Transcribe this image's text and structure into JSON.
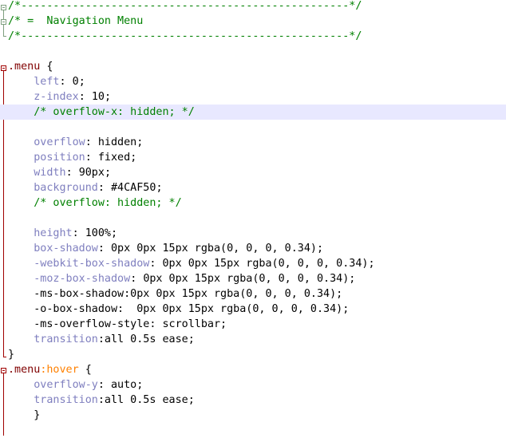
{
  "editor": {
    "lines": [
      [
        [
          "/*---------------------------------------------------*/",
          "t-comment"
        ]
      ],
      [
        [
          "/* =  Navigation Menu",
          "t-comment"
        ]
      ],
      [
        [
          "/*---------------------------------------------------*/",
          "t-comment"
        ]
      ],
      [],
      [
        [
          ".menu",
          "t-selector"
        ],
        [
          " {",
          "t-black"
        ]
      ],
      [
        [
          "    left",
          "t-prop"
        ],
        [
          ": ",
          "t-black"
        ],
        [
          "0",
          "t-black"
        ],
        [
          ";",
          "t-black"
        ]
      ],
      [
        [
          "    z-index",
          "t-prop"
        ],
        [
          ": ",
          "t-black"
        ],
        [
          "10",
          "t-black"
        ],
        [
          ";",
          "t-black"
        ]
      ],
      [
        [
          "    /* overflow-x: hidden; */",
          "t-comment"
        ]
      ],
      [],
      [
        [
          "    overflow",
          "t-prop"
        ],
        [
          ": ",
          "t-black"
        ],
        [
          "hidden",
          "t-black"
        ],
        [
          ";",
          "t-black"
        ]
      ],
      [
        [
          "    position",
          "t-prop"
        ],
        [
          ": ",
          "t-black"
        ],
        [
          "fixed",
          "t-black"
        ],
        [
          ";",
          "t-black"
        ]
      ],
      [
        [
          "    width",
          "t-prop"
        ],
        [
          ": ",
          "t-black"
        ],
        [
          "90px",
          "t-black"
        ],
        [
          ";",
          "t-black"
        ]
      ],
      [
        [
          "    background",
          "t-prop"
        ],
        [
          ": ",
          "t-black"
        ],
        [
          "#4CAF50",
          "t-black"
        ],
        [
          ";",
          "t-black"
        ]
      ],
      [
        [
          "    /* overflow: hidden; */",
          "t-comment"
        ]
      ],
      [],
      [
        [
          "    height",
          "t-prop"
        ],
        [
          ": ",
          "t-black"
        ],
        [
          "100%",
          "t-black"
        ],
        [
          ";",
          "t-black"
        ]
      ],
      [
        [
          "    box-shadow",
          "t-prop"
        ],
        [
          ": ",
          "t-black"
        ],
        [
          "0px 0px 15px rgba(0, 0, 0, 0.34)",
          "t-black"
        ],
        [
          ";",
          "t-black"
        ]
      ],
      [
        [
          "    -webkit-box-shadow",
          "t-prop"
        ],
        [
          ": ",
          "t-black"
        ],
        [
          "0px 0px 15px rgba(0, 0, 0, 0.34)",
          "t-black"
        ],
        [
          ";",
          "t-black"
        ]
      ],
      [
        [
          "    -moz-box-shadow",
          "t-prop"
        ],
        [
          ": ",
          "t-black"
        ],
        [
          "0px 0px 15px rgba(0, 0, 0, 0.34)",
          "t-black"
        ],
        [
          ";",
          "t-black"
        ]
      ],
      [
        [
          "    -ms-box-shadow:0px 0px 15px rgba(0, 0, 0, 0.34);",
          "t-black"
        ]
      ],
      [
        [
          "    -o-box-shadow:  0px 0px 15px rgba(0, 0, 0, 0.34);",
          "t-black"
        ]
      ],
      [
        [
          "    -ms-overflow-style: scrollbar;",
          "t-black"
        ]
      ],
      [
        [
          "    transition",
          "t-prop"
        ],
        [
          ":all 0.5s ease;",
          "t-black"
        ]
      ],
      [
        [
          "}",
          "t-black"
        ]
      ],
      [
        [
          ".menu",
          "t-selector"
        ],
        [
          ":hover",
          "t-pseudo"
        ],
        [
          " {",
          "t-black"
        ]
      ],
      [
        [
          "    overflow-y",
          "t-prop"
        ],
        [
          ": ",
          "t-black"
        ],
        [
          "auto",
          "t-black"
        ],
        [
          ";",
          "t-black"
        ]
      ],
      [
        [
          "    transition",
          "t-prop"
        ],
        [
          ":all 0.5s ease;",
          "t-black"
        ]
      ],
      [
        [
          "    }",
          "t-black"
        ]
      ]
    ],
    "current_line": 8
  }
}
